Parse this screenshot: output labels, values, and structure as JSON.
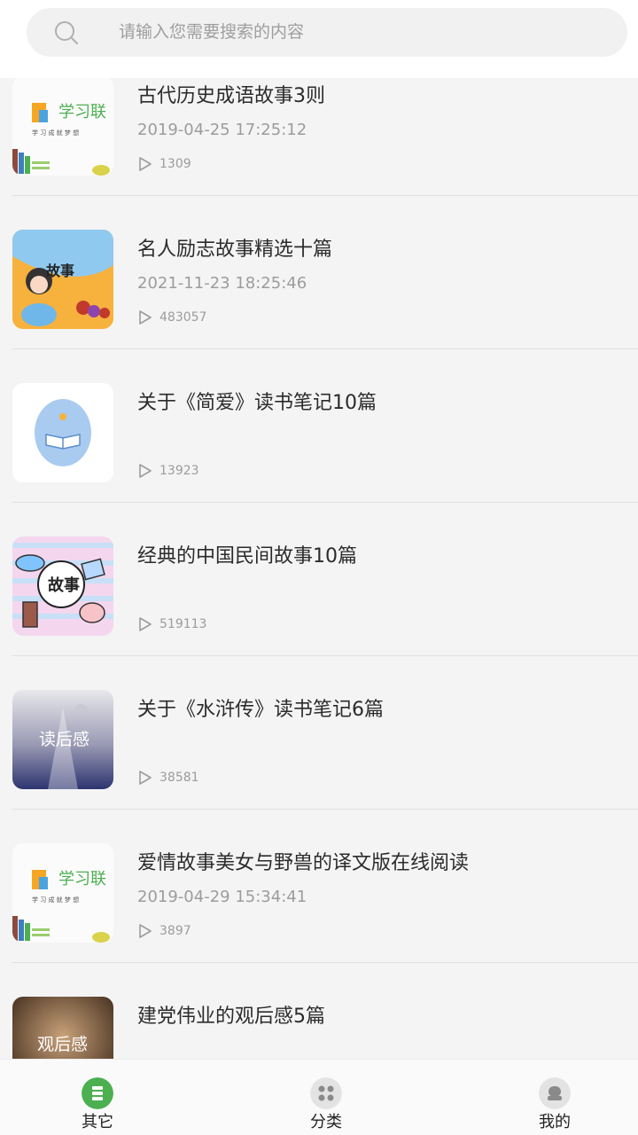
{
  "search": {
    "placeholder": "请输入您需要搜索的内容"
  },
  "list": {
    "items": [
      {
        "title": "古代历史成语故事3则",
        "date": "2019-04-25 17:25:12",
        "plays": "1309"
      },
      {
        "title": "名人励志故事精选十篇",
        "date": "2021-11-23 18:25:46",
        "plays": "483057"
      },
      {
        "title": "关于《简爱》读书笔记10篇",
        "date": "",
        "plays": "13923"
      },
      {
        "title": "经典的中国民间故事10篇",
        "date": "",
        "plays": "519113"
      },
      {
        "title": "关于《水浒传》读书笔记6篇",
        "date": "",
        "plays": "38581"
      },
      {
        "title": "爱情故事美女与野兽的译文版在线阅读",
        "date": "2019-04-29 15:34:41",
        "plays": "3897"
      },
      {
        "title": "建党伟业的观后感5篇",
        "date": "",
        "plays": ""
      }
    ]
  },
  "thumbs": {
    "xuexi_logo": "学习联",
    "gushi": "故事",
    "duhougan": "读后感",
    "guanhougan": "观后感"
  },
  "tabbar": {
    "tabs": [
      {
        "label": "其它"
      },
      {
        "label": "分类"
      },
      {
        "label": "我的"
      }
    ]
  },
  "colors": {
    "active_tab": "#4caf50",
    "inactive_tab_icon": "#d9d9d9",
    "accent": "#4caf50"
  }
}
